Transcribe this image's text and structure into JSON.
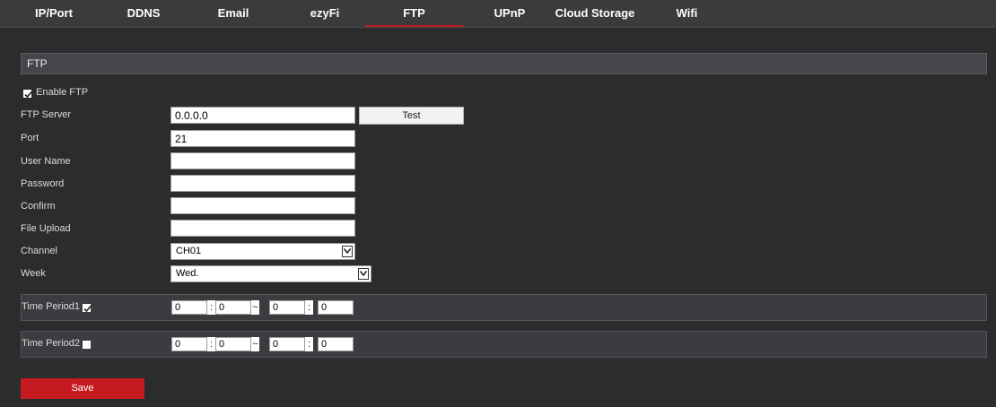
{
  "tabs": [
    {
      "label": "IP/Port"
    },
    {
      "label": "DDNS"
    },
    {
      "label": "Email"
    },
    {
      "label": "ezyFi"
    },
    {
      "label": "FTP"
    },
    {
      "label": "UPnP"
    },
    {
      "label": "Cloud Storage"
    },
    {
      "label": "Wifi"
    }
  ],
  "active_tab": "FTP",
  "accent_color": "#c41a20",
  "section": {
    "title": "FTP"
  },
  "enable": {
    "label": "Enable FTP",
    "checked": true
  },
  "fields": {
    "server": {
      "label": "FTP Server",
      "value": "0.0.0.0"
    },
    "test_button": "Test",
    "port": {
      "label": "Port",
      "value": "21"
    },
    "username": {
      "label": "User Name",
      "value": ""
    },
    "password": {
      "label": "Password",
      "value": ""
    },
    "confirm": {
      "label": "Confirm",
      "value": ""
    },
    "upload": {
      "label": "File Upload",
      "value": ""
    },
    "channel": {
      "label": "Channel",
      "value": "CH01"
    },
    "week": {
      "label": "Week",
      "value": "Wed."
    }
  },
  "periods": [
    {
      "label": "Time Period1",
      "checked": true,
      "start_h": "0",
      "start_m": "0",
      "end_h": "0",
      "end_m": "0"
    },
    {
      "label": "Time Period2",
      "checked": false,
      "start_h": "0",
      "start_m": "0",
      "end_h": "0",
      "end_m": "0"
    }
  ],
  "separators": {
    "colon": ":",
    "tilde": "~"
  },
  "save_label": "Save"
}
